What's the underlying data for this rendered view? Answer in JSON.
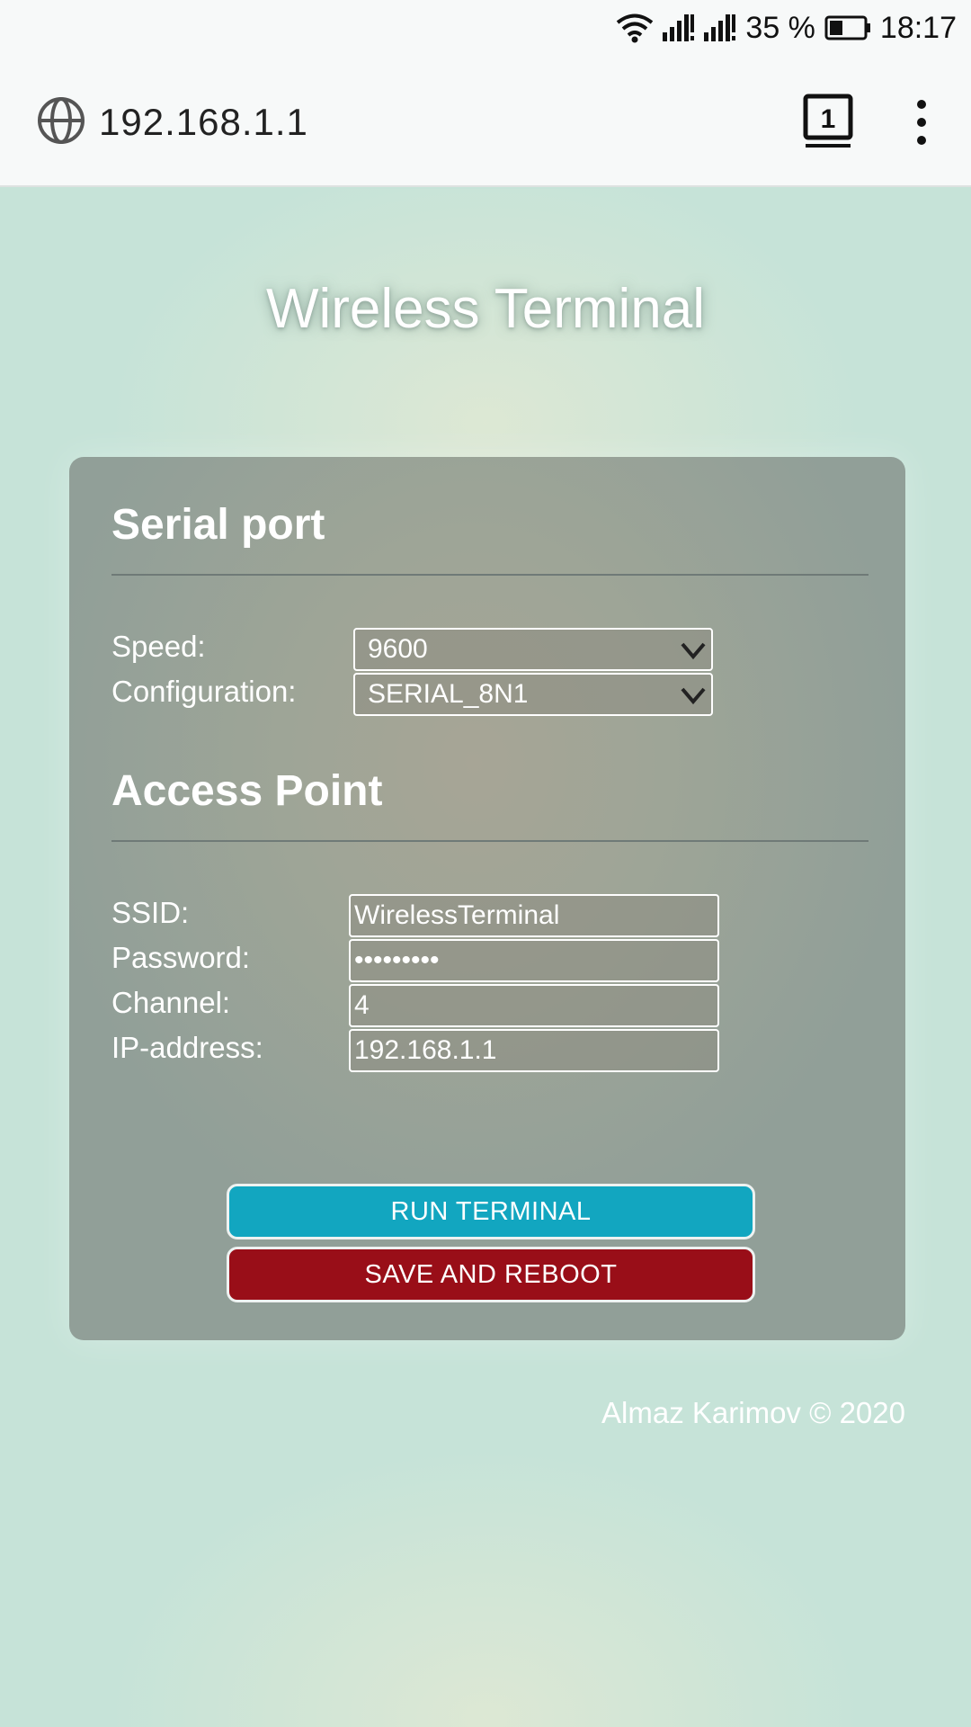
{
  "status_bar": {
    "battery_percent": "35 %",
    "time": "18:17",
    "icons": [
      "wifi-icon",
      "signal-icon",
      "signal-icon",
      "battery-icon"
    ]
  },
  "browser": {
    "url": "192.168.1.1",
    "tab_count": "1",
    "icons": [
      "globe-icon",
      "tabs-icon",
      "more-vert-icon"
    ]
  },
  "page": {
    "title": "Wireless Terminal",
    "serial_port": {
      "heading": "Serial port",
      "speed_label": "Speed:",
      "speed_value": "9600",
      "config_label": "Configuration:",
      "config_value": "SERIAL_8N1"
    },
    "access_point": {
      "heading": "Access Point",
      "ssid_label": "SSID:",
      "ssid_value": "WirelessTerminal",
      "password_label": "Password:",
      "password_value": "•••••••••",
      "channel_label": "Channel:",
      "channel_value": "4",
      "ip_label": "IP-address:",
      "ip_value": "192.168.1.1"
    },
    "buttons": {
      "run": "RUN TERMINAL",
      "save": "SAVE AND REBOOT"
    },
    "footer": "Almaz Karimov © 2020"
  },
  "colors": {
    "background": "#c6e3d8",
    "run_button": "#12a6c0",
    "save_button": "#990e18"
  }
}
